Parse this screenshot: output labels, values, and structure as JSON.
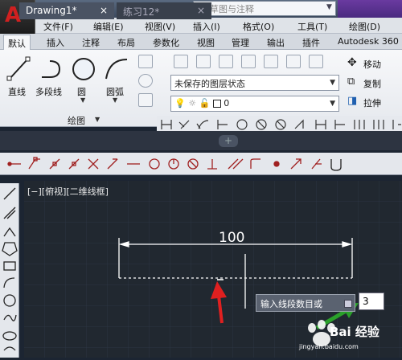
{
  "title_bar": {
    "workspace": "草图与注释",
    "title_right_text": ""
  },
  "menu": [
    "文件(F)",
    "编辑(E)",
    "视图(V)",
    "插入(I)",
    "格式(O)",
    "工具(T)",
    "绘图(D)"
  ],
  "ribbon_tabs": [
    "默认",
    "插入",
    "注释",
    "布局",
    "参数化",
    "视图",
    "管理",
    "输出",
    "插件",
    "Autodesk 360"
  ],
  "draw_panel": {
    "tools": [
      "直线",
      "多段线",
      "圆",
      "圆弧"
    ],
    "label": "绘图"
  },
  "layers": {
    "state": "未保存的图层状态",
    "current": "0"
  },
  "modify": {
    "move": "移动",
    "copy": "复制",
    "stretch": "拉伸"
  },
  "file_tabs": [
    {
      "label": "Drawing1*",
      "close": "×"
    },
    {
      "label": "练习12*",
      "close": "×"
    }
  ],
  "new_tab": "+",
  "viewport_label": "[−][俯视][二维线框]",
  "dimension_value": "100",
  "command_prompt": "输入线段数目或",
  "input_value": "3",
  "watermark": {
    "brand": "Bai  经验",
    "url": "jingyan.baidu.com"
  },
  "colors": {
    "canvas": "#212830",
    "dimension_line": "#ffffff",
    "arrow_red": "#e02020",
    "arrow_green": "#2aa02a"
  },
  "icons": {
    "app": "autocad-logo",
    "qa": [
      "new-icon",
      "open-icon",
      "save-icon",
      "saveas-icon",
      "print-icon",
      "undo-icon",
      "redo-icon"
    ]
  }
}
